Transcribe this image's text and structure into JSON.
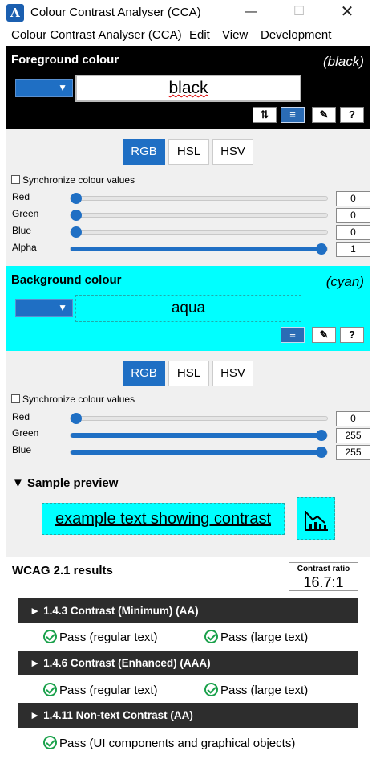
{
  "window": {
    "title": "Colour Contrast Analyser (CCA)",
    "minimize": "—",
    "maximize": "☐",
    "close": "✕"
  },
  "menu": [
    "Colour Contrast Analyser (CCA)",
    "Edit",
    "View",
    "Development"
  ],
  "foreground": {
    "title": "Foreground colour",
    "name": "(black)",
    "value": "black",
    "color": "#000000",
    "tools": [
      "⇅",
      "≡",
      "✎",
      "?"
    ],
    "modes": [
      "RGB",
      "HSL",
      "HSV"
    ],
    "selected_mode": "RGB",
    "sync_label": "Synchronize colour values",
    "sliders": [
      {
        "label": "Red",
        "value": "0",
        "fraction": 0
      },
      {
        "label": "Green",
        "value": "0",
        "fraction": 0
      },
      {
        "label": "Blue",
        "value": "0",
        "fraction": 0
      },
      {
        "label": "Alpha",
        "value": "1",
        "fraction": 1
      }
    ]
  },
  "background": {
    "title": "Background colour",
    "name": "(cyan)",
    "value": "aqua",
    "color": "#00ffff",
    "tools": [
      "≡",
      "✎",
      "?"
    ],
    "modes": [
      "RGB",
      "HSL",
      "HSV"
    ],
    "selected_mode": "RGB",
    "sync_label": "Synchronize colour values",
    "sliders": [
      {
        "label": "Red",
        "value": "0",
        "fraction": 0
      },
      {
        "label": "Green",
        "value": "255",
        "fraction": 1
      },
      {
        "label": "Blue",
        "value": "255",
        "fraction": 1
      }
    ]
  },
  "preview": {
    "title": "▼ Sample preview",
    "sample_text": "example text showing contrast"
  },
  "results": {
    "title": "WCAG 2.1 results",
    "ratio_label": "Contrast ratio",
    "ratio_value": "16.7:1",
    "criteria": [
      {
        "label": "► 1.4.3 Contrast (Minimum) (AA)",
        "passes": [
          "Pass (regular text)",
          "Pass (large text)"
        ]
      },
      {
        "label": "► 1.4.6 Contrast (Enhanced) (AAA)",
        "passes": [
          "Pass (regular text)",
          "Pass (large text)"
        ]
      },
      {
        "label": "► 1.4.11 Non-text Contrast (AA)",
        "passes": [
          "Pass (UI components and graphical objects)"
        ]
      }
    ]
  },
  "colors": {
    "accent": "#1f6fc4",
    "pass": "#1aa14b",
    "panel": "#f0f0f0"
  }
}
